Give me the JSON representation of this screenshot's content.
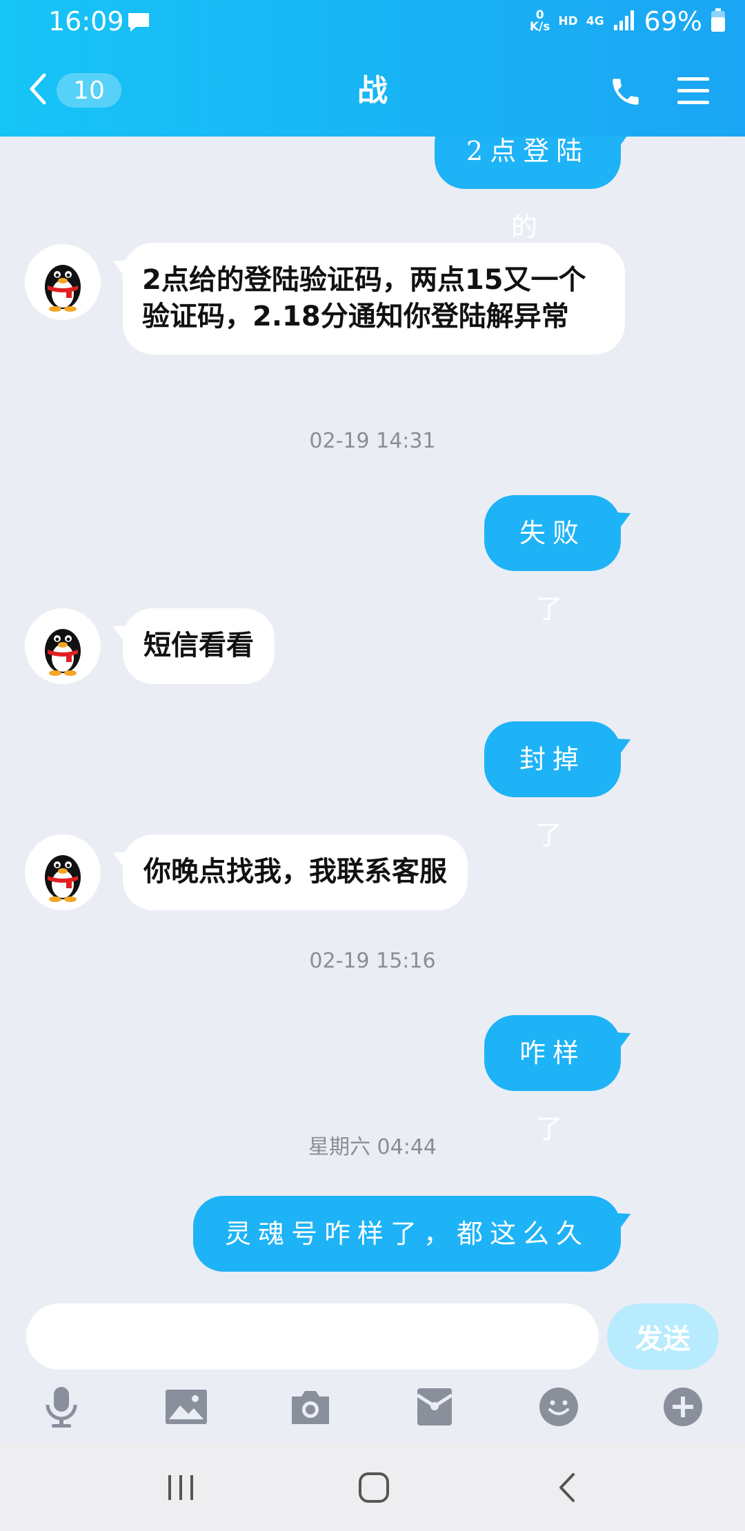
{
  "status_bar": {
    "time": "16:09",
    "net_speed_value": "0",
    "net_speed_unit": "K/s",
    "hd": "HD",
    "network": "4G",
    "battery": "69%",
    "icons": [
      "message-icon",
      "signal-icon",
      "battery-icon"
    ]
  },
  "header": {
    "back_count": "10",
    "title": "战",
    "icons": [
      "back-chevron-icon",
      "phone-icon",
      "menu-icon"
    ]
  },
  "messages": [
    {
      "type": "out",
      "text": "2点登陆的"
    },
    {
      "type": "in",
      "text": "2点给的登陆验证码，两点15又一个验证码，2.18分通知你登陆解异常"
    },
    {
      "type": "timestamp",
      "text": "02-19 14:31"
    },
    {
      "type": "out",
      "text": "失败了"
    },
    {
      "type": "in",
      "text": "短信看看"
    },
    {
      "type": "out",
      "text": "封掉了"
    },
    {
      "type": "in",
      "text": "你晚点找我，我联系客服"
    },
    {
      "type": "timestamp",
      "text": "02-19 15:16"
    },
    {
      "type": "out",
      "text": "咋样了"
    },
    {
      "type": "timestamp",
      "text": "星期六 04:44"
    },
    {
      "type": "out",
      "text": "灵魂号咋样了，都这么久了"
    }
  ],
  "input": {
    "value": "",
    "send_label": "发送"
  },
  "toolbar": {
    "icons": [
      "microphone-icon",
      "image-icon",
      "camera-icon",
      "red-packet-icon",
      "emoji-icon",
      "plus-icon"
    ]
  },
  "navbar": {
    "icons": [
      "recent-apps-icon",
      "home-icon",
      "back-icon"
    ]
  },
  "colors": {
    "header_start": "#16c4f6",
    "header_end": "#1aa6f4",
    "outgoing_bubble": "#1eb3f6",
    "incoming_bubble": "#ffffff",
    "chat_background": "#ebedf5",
    "send_button_disabled": "#b7ebfd",
    "icon_gray": "#8a8f9c"
  }
}
